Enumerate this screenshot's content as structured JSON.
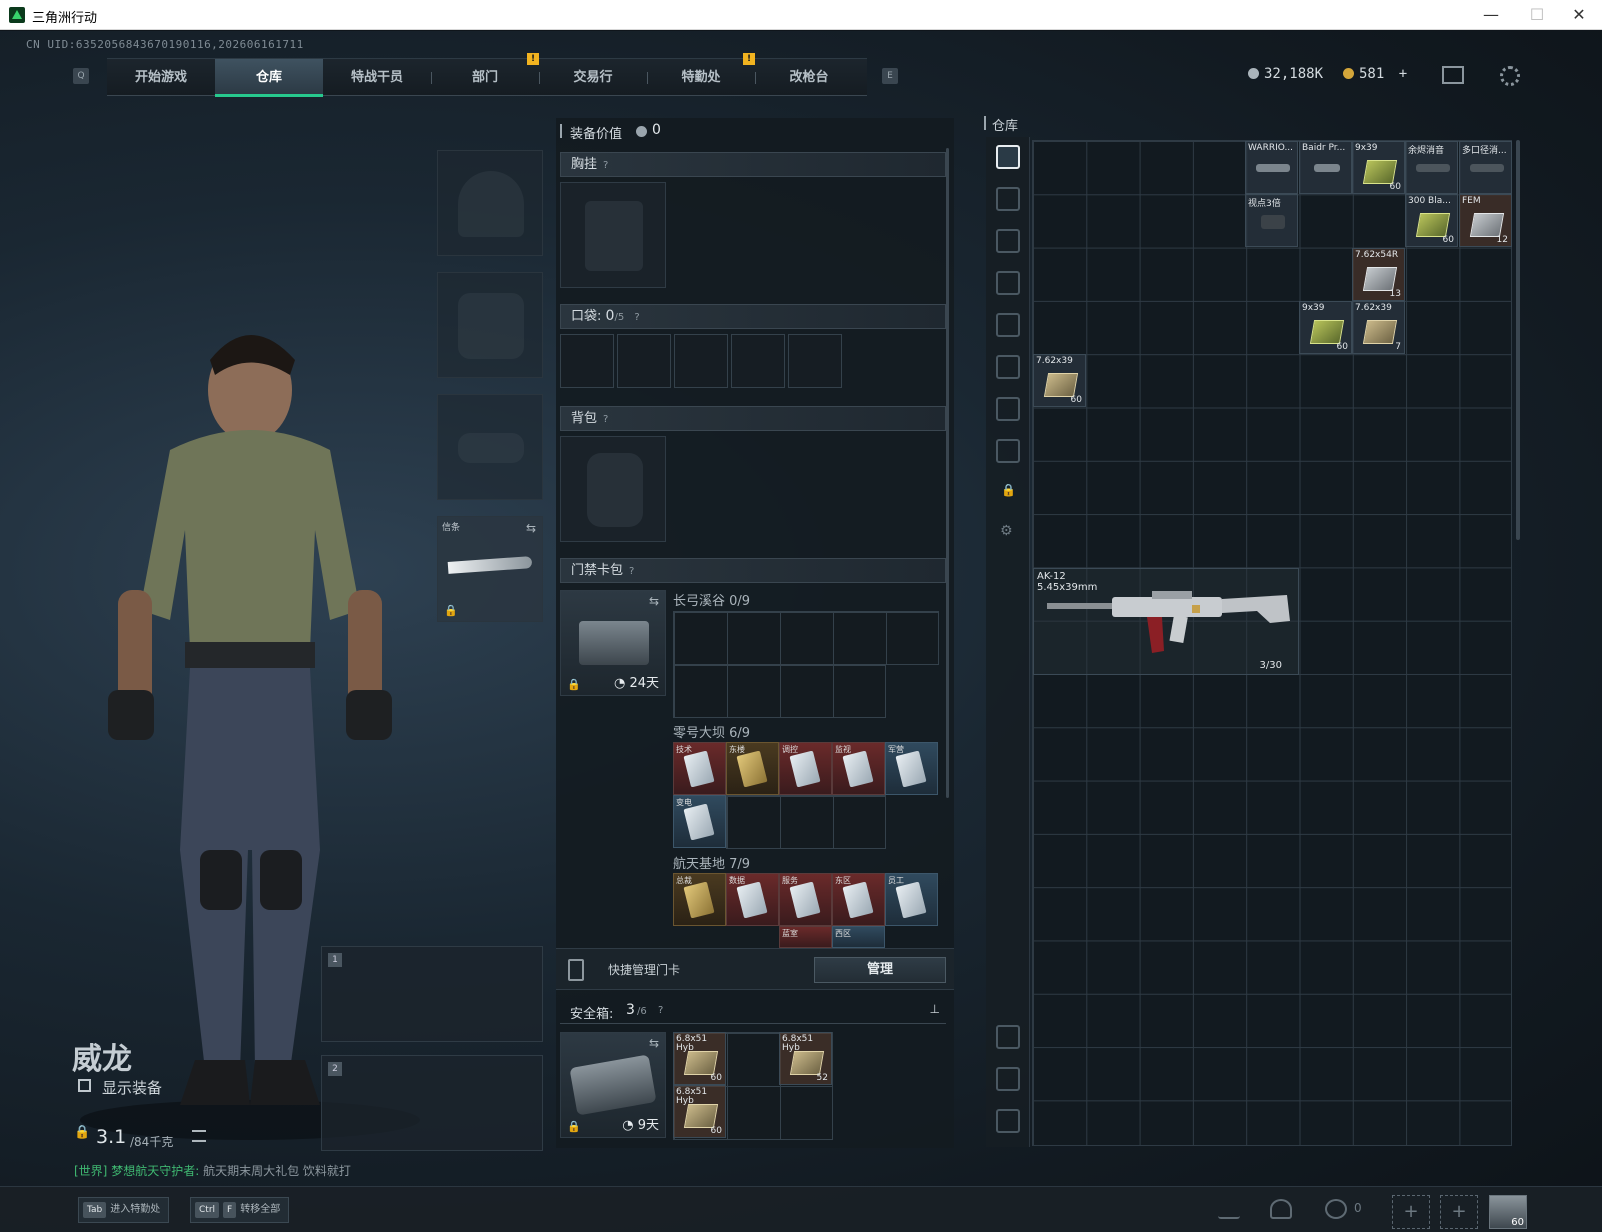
{
  "window": {
    "title": "三角洲行动",
    "minimize": "—",
    "maximize": "☐",
    "close": "✕"
  },
  "uid": "CN UID:63520568436701901​16,2026061617​11",
  "nav": {
    "left_key": "Q",
    "right_key": "E",
    "tabs": [
      "开始游戏",
      "仓库",
      "特战干员",
      "部门",
      "交易行",
      "特勤处",
      "改枪台"
    ],
    "active": "仓库",
    "badges": [
      "!",
      "!"
    ]
  },
  "currency": {
    "silver": "32,188K",
    "gold": "581",
    "plus": "+"
  },
  "character": {
    "name": "威龙",
    "show_gear_label": "显示装备",
    "weight": "3.1",
    "weight_max": "/84千克"
  },
  "melee_slot": {
    "label": "信条"
  },
  "weapon_slots": [
    "1",
    "2"
  ],
  "chat": {
    "channel": "[世界]",
    "user": "梦想航天守护者:",
    "message": "航天期末周大礼包 饮料就打"
  },
  "equipment": {
    "value_label": "装备价值",
    "value": "0",
    "chest_label": "胸挂",
    "pocket_label": "口袋:",
    "pocket_count": "0",
    "pocket_max": "/5",
    "backpack_label": "背包",
    "keycard_label": "门禁卡包",
    "keycard_days": "24天",
    "maps": [
      {
        "name": "长弓溪谷",
        "count": "0/9",
        "cards": []
      },
      {
        "name": "零号大坝",
        "count": "6/9",
        "cards": [
          "技术",
          "东楼",
          "调控",
          "监视",
          "军营",
          "变电"
        ]
      },
      {
        "name": "航天基地",
        "count": "7/9",
        "cards": [
          "总裁",
          "数据",
          "服务",
          "东区",
          "员工",
          "蓝室",
          "西区"
        ]
      }
    ],
    "quick_manage_label": "快捷管理门卡",
    "manage_button": "管理",
    "safe_label": "安全箱:",
    "safe_count": "3",
    "safe_max": "/6",
    "safe_days": "9天",
    "safe_items": [
      {
        "label": "6.8x51",
        "sub": "Hyb",
        "count": "60"
      },
      {
        "label": "6.8x51",
        "sub": "Hyb",
        "count": "52"
      },
      {
        "label": "6.8x51",
        "sub": "Hyb",
        "count": "60"
      }
    ]
  },
  "storage": {
    "title": "仓库",
    "items": [
      {
        "label": "WARRIO...",
        "count": ""
      },
      {
        "label": "Baidr Pr...",
        "count": ""
      },
      {
        "label": "9x39",
        "count": "60"
      },
      {
        "label": "余烬消音",
        "count": ""
      },
      {
        "label": "多口径消...",
        "count": ""
      },
      {
        "label": "视点3倍",
        "count": ""
      },
      {
        "label": "300 Bla...",
        "count": "60"
      },
      {
        "label": "FEM",
        "count": "12"
      },
      {
        "label": "7.62x54R",
        "count": "13"
      },
      {
        "label": "9x39",
        "count": "60"
      },
      {
        "label": "7.62x39",
        "count": "7"
      },
      {
        "label": "7.62x39",
        "count": "60"
      }
    ],
    "weapon": {
      "name": "AK-12",
      "caliber": "5.45x39mm",
      "ammo": "3/30"
    }
  },
  "bottom": {
    "tab_key": "Tab",
    "tab_label": "进入特勤处",
    "ctrl_key": "Ctrl",
    "f_key": "F",
    "transfer_label": "转移全部",
    "team_count": "0",
    "plus1": "+",
    "plus2": "+",
    "corner_count": "60"
  }
}
